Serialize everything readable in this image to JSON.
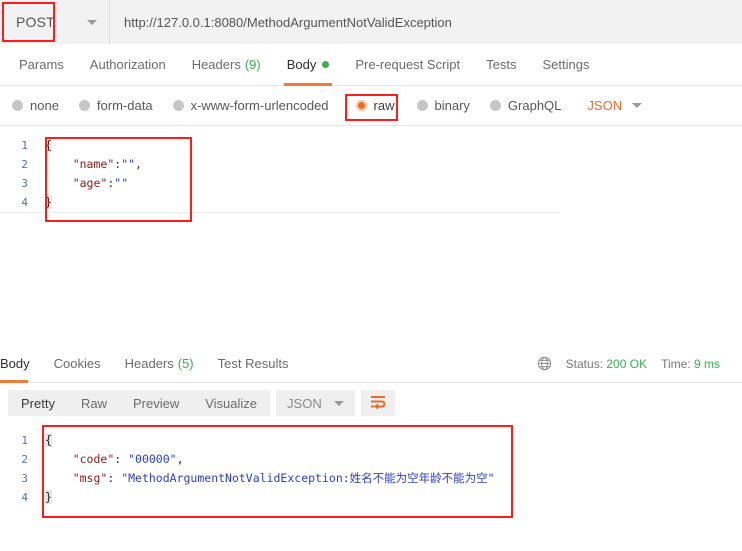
{
  "request": {
    "method": "POST",
    "method_chevron_icon": "chevron-down-icon",
    "url": "http://127.0.0.1:8080/MethodArgumentNotValidException",
    "tabs": [
      {
        "label": "Params",
        "active": false
      },
      {
        "label": "Authorization",
        "active": false
      },
      {
        "label": "Headers",
        "count": "(9)",
        "active": false
      },
      {
        "label": "Body",
        "active": true,
        "has_dot": true
      },
      {
        "label": "Pre-request Script",
        "active": false
      },
      {
        "label": "Tests",
        "active": false
      },
      {
        "label": "Settings",
        "active": false
      }
    ],
    "body_types": [
      {
        "label": "none",
        "selected": false
      },
      {
        "label": "form-data",
        "selected": false
      },
      {
        "label": "x-www-form-urlencoded",
        "selected": false
      },
      {
        "label": "raw",
        "selected": true
      },
      {
        "label": "binary",
        "selected": false
      },
      {
        "label": "GraphQL",
        "selected": false
      }
    ],
    "body_format": "JSON",
    "body_lines": [
      {
        "num": "1",
        "punct": "{",
        "key": "",
        "colon": "",
        "str": "",
        "comma": ""
      },
      {
        "num": "2",
        "punct": "",
        "key": "\"name\"",
        "colon": ":",
        "str": "\"\"",
        "comma": ","
      },
      {
        "num": "3",
        "punct": "",
        "key": "\"age\"",
        "colon": ":",
        "str": "\"\"",
        "comma": ""
      },
      {
        "num": "4",
        "punct": "}",
        "key": "",
        "colon": "",
        "str": "",
        "comma": ""
      }
    ]
  },
  "response": {
    "tabs": [
      {
        "label": "Body",
        "active": true
      },
      {
        "label": "Cookies",
        "active": false
      },
      {
        "label": "Headers",
        "count": "(5)",
        "active": false
      },
      {
        "label": "Test Results",
        "active": false
      }
    ],
    "globe_icon": "globe-icon",
    "status_label": "Status:",
    "status_value": "200 OK",
    "time_label": "Time:",
    "time_value": "9 ms",
    "view_modes": [
      {
        "label": "Pretty",
        "active": true
      },
      {
        "label": "Raw",
        "active": false
      },
      {
        "label": "Preview",
        "active": false
      },
      {
        "label": "Visualize",
        "active": false
      }
    ],
    "view_format": "JSON",
    "wrap_icon": "wrap-lines-icon",
    "body_lines": [
      {
        "num": "1",
        "punct": "{",
        "key": "",
        "colon": "",
        "str": "",
        "comma": ""
      },
      {
        "num": "2",
        "punct": "",
        "key": "\"code\"",
        "colon": ": ",
        "str": "\"00000\"",
        "comma": ","
      },
      {
        "num": "3",
        "punct": "",
        "key": "\"msg\"",
        "colon": ": ",
        "str": "\"MethodArgumentNotValidException:姓名不能为空年龄不能为空\"",
        "comma": ""
      },
      {
        "num": "4",
        "punct": "}",
        "key": "",
        "colon": "",
        "str": "",
        "comma": ""
      }
    ]
  },
  "annotations": {
    "color": "#fd1d1d",
    "boxes": [
      "method-highlight",
      "raw-highlight",
      "request-body-highlight",
      "response-body-highlight"
    ]
  }
}
